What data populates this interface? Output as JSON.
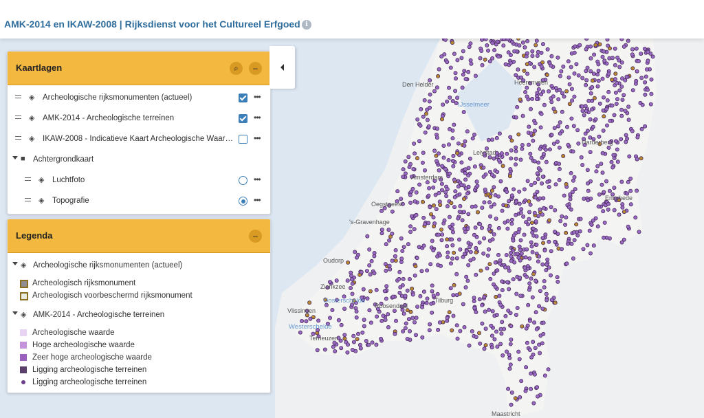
{
  "header": {
    "title": "AMK-2014 en IKAW-2008 | Rijksdienst voor het Cultureel Erfgoed",
    "info_icon": "info-icon"
  },
  "layers_panel": {
    "title": "Kaartlagen",
    "search_icon": "search-icon",
    "collapse_icon": "minus-icon",
    "items": [
      {
        "label": "Archeologische rijksmonumenten (actueel)",
        "control": "checkbox",
        "checked": true
      },
      {
        "label": "AMK-2014 - Archeologische terreinen",
        "control": "checkbox",
        "checked": true
      },
      {
        "label": "IKAW-2008 - Indicatieve Kaart Archeologische Waarden",
        "control": "checkbox",
        "checked": false
      }
    ],
    "group": {
      "label": "Achtergrondkaart",
      "icon": "folder-icon",
      "items": [
        {
          "label": "Luchtfoto",
          "control": "radio",
          "checked": false
        },
        {
          "label": "Topografie",
          "control": "radio",
          "checked": true
        }
      ]
    },
    "more_label": "•••"
  },
  "legend_panel": {
    "title": "Legenda",
    "collapse_icon": "minus-icon",
    "sections": [
      {
        "title": "Archeologische rijksmonumenten (actueel)",
        "items": [
          {
            "label": "Archeologisch rijksmonument",
            "swatch": "#8f8f8f",
            "border": "#8a6d1e"
          },
          {
            "label": "Archeologisch voorbeschermd rijksmonument",
            "swatch": "#e8ece0",
            "border": "#8a6d1e"
          }
        ]
      },
      {
        "title": "AMK-2014 - Archeologische terreinen",
        "items": [
          {
            "label": "Archeologische waarde",
            "swatch": "#e9d3f2"
          },
          {
            "label": "Hoge archeologische waarde",
            "swatch": "#c394dc"
          },
          {
            "label": "Zeer hoge archeologische waarde",
            "swatch": "#9b5fbf"
          },
          {
            "label": "Ligging archeologische terreinen",
            "swatch": "#5b3f6b"
          },
          {
            "label": "Ligging archeologische terreinen",
            "swatch": "#6a3e8a",
            "shape": "dot"
          }
        ]
      }
    ]
  },
  "map": {
    "places": [
      "Den Helder",
      "Heerenveen",
      "Lelystad",
      "Harderberg",
      "Amsterdam",
      "Enschede",
      "Oegstgeest",
      "'s-Gravenhage",
      "Oudorp",
      "Tilburg",
      "Roosendaal",
      "Zierikzee",
      "Vlissingen",
      "Terneuzen",
      "Maastricht"
    ],
    "water": [
      "IJsselmeer",
      "Oosterschelde",
      "Westerschelde"
    ],
    "colors": {
      "background": "#eef0f2",
      "sea": "#dde7f2",
      "dot": "#9a6bc4",
      "dot_dark": "#4a2a5e",
      "accent": "#f3b83f",
      "title": "#2f6d9c"
    }
  }
}
